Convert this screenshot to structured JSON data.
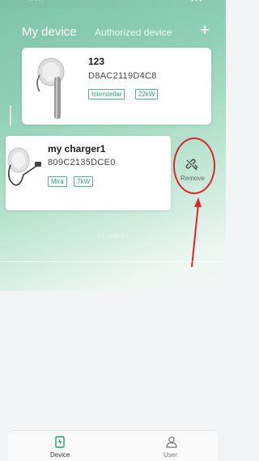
{
  "header": {
    "title": "My device",
    "tab_authorized": "Authorized device",
    "add_symbol": "+"
  },
  "devices": [
    {
      "name": "123",
      "id": "D8AC2119D4C8",
      "tags": [
        "Interstellar",
        "22kW"
      ]
    },
    {
      "name": "my charger1",
      "id": "809C2135DCE0",
      "tags": [
        "Mira",
        "7kW"
      ]
    }
  ],
  "swipe_action": {
    "label": "Remove",
    "icon": "unlink-icon"
  },
  "list_footer": "- Loaded -",
  "nav": {
    "device_label": "Device",
    "user_label": "User"
  },
  "colors": {
    "accent": "#2f9c72",
    "highlight_red": "#d9272e"
  }
}
